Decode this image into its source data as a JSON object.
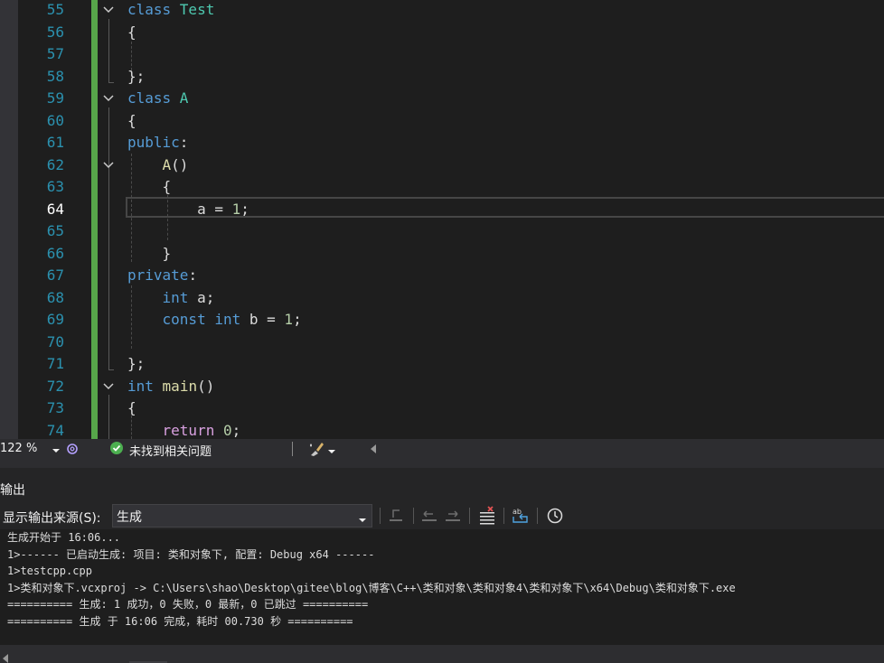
{
  "editor": {
    "lines": [
      {
        "num": "55",
        "tokens": [
          {
            "t": "class ",
            "c": "kw"
          },
          {
            "t": "Test",
            "c": "cls"
          }
        ]
      },
      {
        "num": "56",
        "tokens": [
          {
            "t": "{",
            "c": ""
          }
        ]
      },
      {
        "num": "57",
        "tokens": []
      },
      {
        "num": "58",
        "tokens": [
          {
            "t": "};",
            "c": ""
          }
        ]
      },
      {
        "num": "59",
        "tokens": [
          {
            "t": "class ",
            "c": "kw"
          },
          {
            "t": "A",
            "c": "cls"
          }
        ]
      },
      {
        "num": "60",
        "tokens": [
          {
            "t": "{",
            "c": ""
          }
        ]
      },
      {
        "num": "61",
        "tokens": [
          {
            "t": "public",
            "c": "kw"
          },
          {
            "t": ":",
            "c": ""
          }
        ]
      },
      {
        "num": "62",
        "tokens": [
          {
            "t": "    ",
            "c": ""
          },
          {
            "t": "A",
            "c": "fn"
          },
          {
            "t": "()",
            "c": ""
          }
        ]
      },
      {
        "num": "63",
        "tokens": [
          {
            "t": "    {",
            "c": ""
          }
        ]
      },
      {
        "num": "64",
        "tokens": [
          {
            "t": "        a = ",
            "c": ""
          },
          {
            "t": "1",
            "c": "num"
          },
          {
            "t": ";",
            "c": ""
          }
        ]
      },
      {
        "num": "65",
        "tokens": []
      },
      {
        "num": "66",
        "tokens": [
          {
            "t": "    }",
            "c": ""
          }
        ]
      },
      {
        "num": "67",
        "tokens": [
          {
            "t": "private",
            "c": "kw"
          },
          {
            "t": ":",
            "c": ""
          }
        ]
      },
      {
        "num": "68",
        "tokens": [
          {
            "t": "    ",
            "c": ""
          },
          {
            "t": "int",
            "c": "kw"
          },
          {
            "t": " a;",
            "c": ""
          }
        ]
      },
      {
        "num": "69",
        "tokens": [
          {
            "t": "    ",
            "c": ""
          },
          {
            "t": "const",
            "c": "kw"
          },
          {
            "t": " ",
            "c": ""
          },
          {
            "t": "int",
            "c": "kw"
          },
          {
            "t": " b = ",
            "c": ""
          },
          {
            "t": "1",
            "c": "num"
          },
          {
            "t": ";",
            "c": ""
          }
        ]
      },
      {
        "num": "70",
        "tokens": []
      },
      {
        "num": "71",
        "tokens": [
          {
            "t": "};",
            "c": ""
          }
        ]
      },
      {
        "num": "72",
        "tokens": [
          {
            "t": "int",
            "c": "kw"
          },
          {
            "t": " ",
            "c": ""
          },
          {
            "t": "main",
            "c": "fn"
          },
          {
            "t": "()",
            "c": ""
          }
        ]
      },
      {
        "num": "73",
        "tokens": [
          {
            "t": "{",
            "c": ""
          }
        ]
      },
      {
        "num": "74",
        "tokens": [
          {
            "t": "    ",
            "c": ""
          },
          {
            "t": "return",
            "c": "ctl"
          },
          {
            "t": " ",
            "c": ""
          },
          {
            "t": "0",
            "c": "num"
          },
          {
            "t": ";",
            "c": ""
          }
        ]
      }
    ],
    "active_line": "64",
    "fold_lines": [
      "55",
      "59",
      "62",
      "72"
    ]
  },
  "status": {
    "zoom": "122 %",
    "issues_text": "未找到相关问题"
  },
  "output": {
    "title": "输出",
    "source_label": "显示输出来源(S):",
    "source_value": "生成",
    "lines": [
      "生成开始于 16:06...",
      "1>------ 已启动生成: 项目: 类和对象下, 配置: Debug x64 ------",
      "1>testcpp.cpp",
      "1>类和对象下.vcxproj -> C:\\Users\\shao\\Desktop\\gitee\\blog\\博客\\C++\\类和对象\\类和对象4\\类和对象下\\x64\\Debug\\类和对象下.exe",
      "========== 生成: 1 成功，0 失败，0 最新，0 已跳过 ==========",
      "========== 生成 于 16:06 完成，耗时 00.730 秒 =========="
    ]
  },
  "colors": {
    "keyword": "#569cd6",
    "type": "#4ec9b0",
    "function": "#dcdcaa",
    "number": "#b5cea8",
    "control": "#d8a0df",
    "line_number": "#2b91af",
    "change_bar": "#57a64a",
    "success": "#4caf50"
  }
}
